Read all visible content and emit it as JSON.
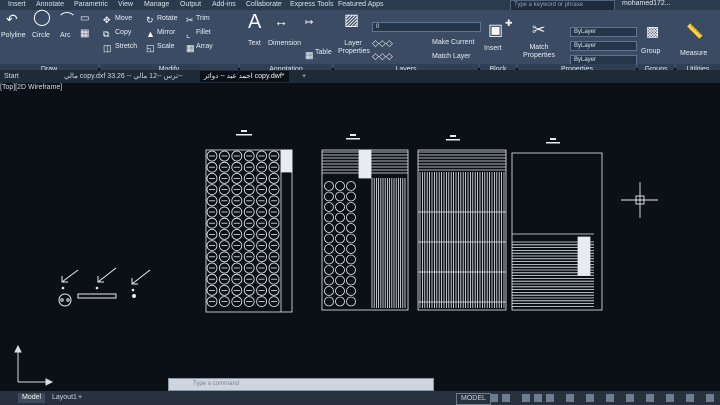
{
  "menu": [
    "Insert",
    "Annotate",
    "Parametric",
    "View",
    "Manage",
    "Output",
    "Add-ins",
    "Collaborate",
    "Express Tools",
    "Featured Apps"
  ],
  "search_placeholder": "Type a keyword or phrase",
  "user_name": "mohamed172...",
  "ribbon": {
    "draw_tools": [
      "Polyline",
      "Circle",
      "Arc"
    ],
    "modify_tools": [
      "Move",
      "Rotate",
      "Trim",
      "Copy",
      "Mirror",
      "Fillet",
      "Stretch",
      "Scale",
      "Array"
    ],
    "annotation_tools": [
      "Text",
      "Dimension",
      "Table"
    ],
    "layer_tools": [
      "Layer Properties",
      "Make Current",
      "Match Layer"
    ],
    "layer_value": "0",
    "block_tools": [
      "Insert"
    ],
    "properties_tools": [
      "Match Properties"
    ],
    "bylayer": [
      "ByLayer",
      "ByLayer",
      "ByLayer"
    ],
    "group_tools": [
      "Group"
    ],
    "utilities_tools": [
      "Measure"
    ],
    "panels": [
      "Draw",
      "Modify",
      "Annotation",
      "Layers",
      "Block",
      "Properties",
      "Groups",
      "Utilities"
    ]
  },
  "file_tabs": [
    "Start",
    "مالي copy.dxf 33.26 -- ترس --12 مالي--",
    "احمد عبد -- دوائر copy.dwf*"
  ],
  "view_label": "[Top][2D Wireframe]",
  "command_placeholder": "Type a command",
  "layout_tabs": [
    "Model",
    "Layout1"
  ],
  "status": {
    "model_button": "MODEL"
  },
  "colors": {
    "ribbon": "#3a4b63",
    "canvas": "#0b0f16",
    "drawing": "#e8ecf2"
  }
}
